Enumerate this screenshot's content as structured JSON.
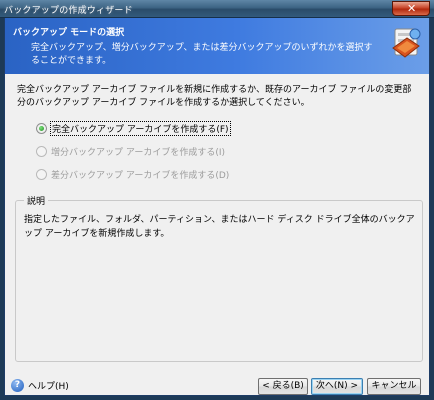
{
  "window": {
    "title": "バックアップの作成ウィザード"
  },
  "header": {
    "title": "バックアップ モードの選択",
    "description": "完全バックアップ、増分バックアップ、または差分バックアップのいずれかを選択することができます。"
  },
  "intro": "完全バックアップ アーカイブ ファイルを新規に作成するか、既存のアーカイブ ファイルの変更部分のバックアップ アーカイブ ファイルを作成するか選択してください。",
  "options": [
    {
      "label": "完全バックアップ アーカイブを作成する(F)",
      "checked": true,
      "enabled": true
    },
    {
      "label": "増分バックアップ アーカイブを作成する(I)",
      "checked": false,
      "enabled": false
    },
    {
      "label": "差分バックアップ アーカイブを作成する(D)",
      "checked": false,
      "enabled": false
    }
  ],
  "description_group": {
    "title": "説明",
    "text": "指定したファイル、フォルダ、パーティション、またはハード ディスク ドライブ全体のバックアップ アーカイブを新規作成します。"
  },
  "buttons": {
    "help": "ヘルプ(H)",
    "back": "< 戻る(B)",
    "next": "次へ(N) >",
    "cancel": "キャンセル"
  }
}
